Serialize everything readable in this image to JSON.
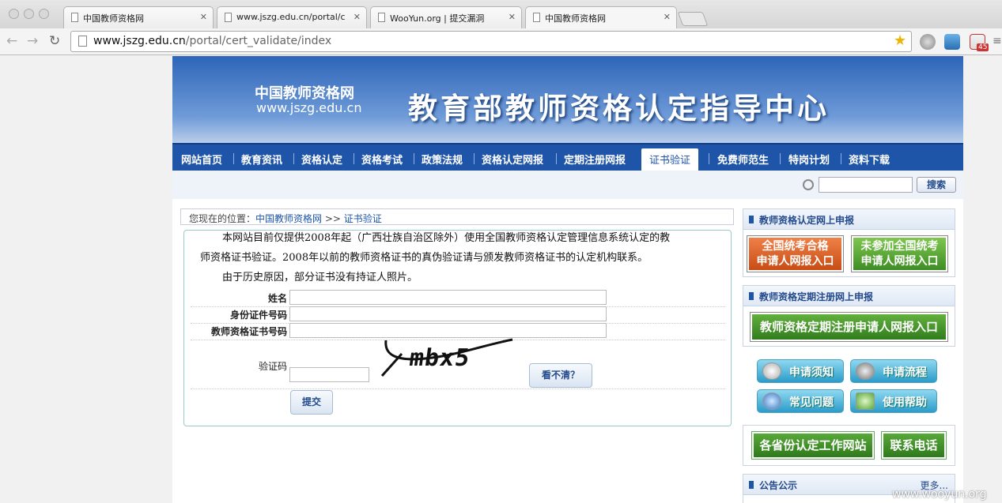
{
  "browser": {
    "tabs": [
      {
        "title": "中国教师资格网"
      },
      {
        "title": "www.jszg.edu.cn/portal/c"
      },
      {
        "title": "WooYun.org | 提交漏洞"
      },
      {
        "title": "中国教师资格网"
      }
    ],
    "url_host": "www.jszg.edu.cn",
    "url_path": "/portal/cert_validate/index",
    "mail_badge": "45"
  },
  "site": {
    "logo_cn": "中国教师资格网",
    "logo_en": "www.jszg.edu.cn",
    "banner_title": "教育部教师资格认定指导中心",
    "nav": [
      "网站首页",
      "教育资讯",
      "资格认定",
      "资格考试",
      "政策法规",
      "资格认定网报",
      "定期注册网报",
      "证书验证",
      "免费师范生",
      "特岗计划",
      "资料下载"
    ],
    "search_button": "搜索",
    "breadcrumb": {
      "prefix": "您现在的位置：",
      "home": "中国教师资格网",
      "sep": " >> ",
      "current": "证书验证"
    }
  },
  "form": {
    "notice_line1": "本网站目前仅提供2008年起（广西壮族自治区除外）使用全国教师资格认定管理信息系统认定的教",
    "notice_line2": "师资格证书验证。2008年以前的教师资格证书的真伪验证请与颁发教师资格证书的认定机构联系。",
    "notice_line3": "由于历史原因，部分证书没有持证人照片。",
    "name_label": "姓名",
    "id_label": "身份证件号码",
    "cert_label": "教师资格证书号码",
    "captcha_label": "验证码",
    "captcha_text": "mbx5",
    "refresh_button": "看不清？",
    "submit_button": "提交"
  },
  "sidebar": {
    "box1_title": "教师资格认定网上申报",
    "btn_orange_l1": "全国统考合格",
    "btn_orange_l2": "申请人网报入口",
    "btn_green_l1": "未参加全国统考",
    "btn_green_l2": "申请人网报入口",
    "box2_title": "教师资格定期注册网上申报",
    "btn_register": "教师资格定期注册申请人网报入口",
    "icon_btns": [
      "申请须知",
      "申请流程",
      "常见问题",
      "使用帮助"
    ],
    "link_provinces": "各省份认定工作网站",
    "link_contact": "联系电话",
    "box3_title": "公告公示",
    "more": "更多..."
  },
  "watermark": "www.wooyun.org",
  "colors": {
    "nav_blue": "#1f55a8",
    "orange": "#e0672a",
    "green": "#4a9a2e"
  }
}
